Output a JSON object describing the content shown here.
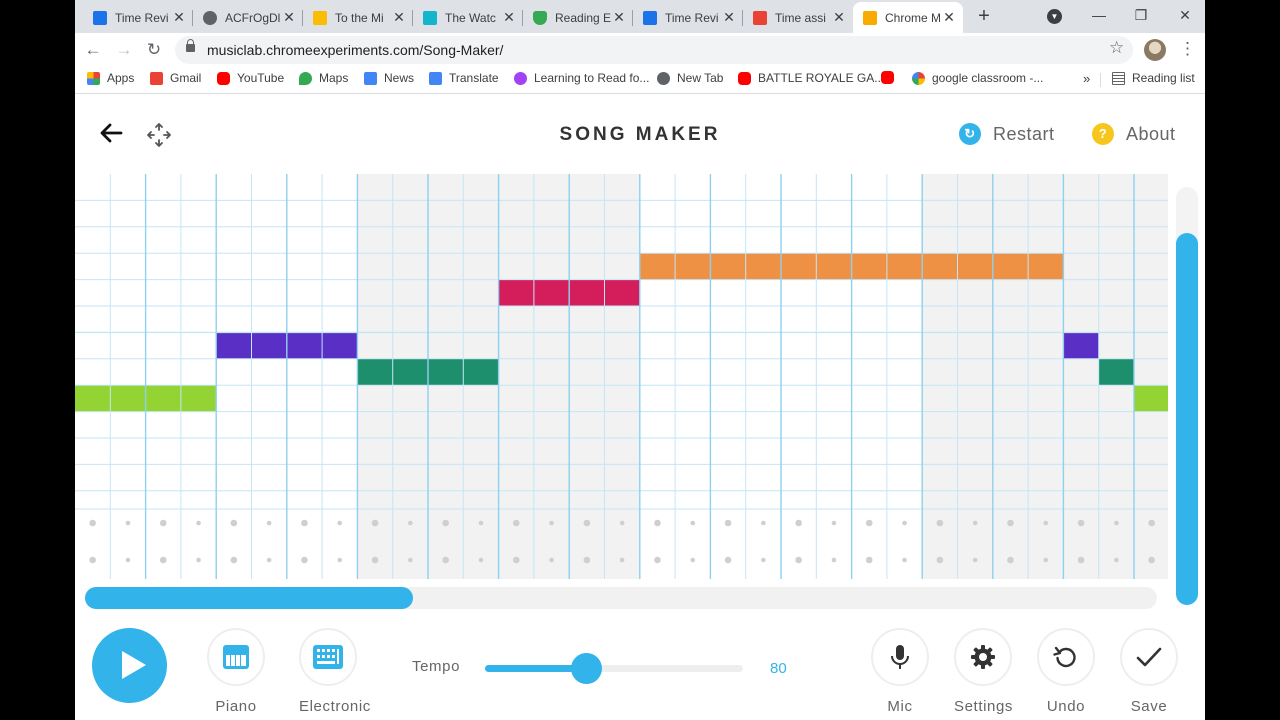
{
  "tabs": [
    {
      "label": "Time Revi",
      "fav": "#1a73e8",
      "icon": "classroom-icon"
    },
    {
      "label": "ACFrOgDl",
      "fav": "#5f6368",
      "icon": "globe-icon"
    },
    {
      "label": "To the Mi",
      "fav": "#fbbc04",
      "icon": "slides-icon"
    },
    {
      "label": "The Watc",
      "fav": "#12b5cb",
      "icon": "site-icon"
    },
    {
      "label": "Reading E",
      "fav": "#34a853",
      "icon": "shield-icon"
    },
    {
      "label": "Time Revi",
      "fav": "#1a73e8",
      "icon": "classroom-icon"
    },
    {
      "label": "Time assi",
      "fav": "#ea4335",
      "icon": "gmail-icon"
    },
    {
      "label": "Chrome M",
      "fav": "#f9ab00",
      "icon": "chrome-music-lab-icon"
    }
  ],
  "new_tab_symbol": "+",
  "window": {
    "minimize": "—",
    "restore": "❐",
    "close": "✕"
  },
  "toolbar": {
    "back": "←",
    "forward": "→",
    "reload": "↻",
    "url": "musiclab.chromeexperiments.com/Song-Maker/",
    "star": "☆",
    "menu": "⋮"
  },
  "bookmarks": [
    {
      "label": "Apps",
      "fav": "#ea4335",
      "icon": "apps-grid-icon"
    },
    {
      "label": "Gmail",
      "fav": "#ea4335",
      "icon": "gmail-icon"
    },
    {
      "label": "YouTube",
      "fav": "#ff0000",
      "icon": "youtube-icon"
    },
    {
      "label": "Maps",
      "fav": "#34a853",
      "icon": "maps-icon"
    },
    {
      "label": "News",
      "fav": "#4285f4",
      "icon": "news-icon"
    },
    {
      "label": "Translate",
      "fav": "#4285f4",
      "icon": "translate-icon"
    },
    {
      "label": "Learning to Read fo...",
      "fav": "#a142f4",
      "icon": "egg-icon"
    },
    {
      "label": "New Tab",
      "fav": "#5f6368",
      "icon": "globe-icon"
    },
    {
      "label": "BATTLE ROYALE GA...",
      "fav": "#ff0000",
      "icon": "youtube-icon"
    },
    {
      "label": "",
      "fav": "#ff0000",
      "icon": "youtube-icon"
    },
    {
      "label": "google classroom -...",
      "fav": "#4285f4",
      "icon": "google-icon"
    }
  ],
  "bookmarks_more": "»",
  "reading_list": "Reading list",
  "app": {
    "title": "SONG MAKER",
    "restart": "Restart",
    "about": "About",
    "about_glyph": "?",
    "restart_glyph": "↻"
  },
  "melody": [
    {
      "col": 0,
      "len": 4,
      "row": 8,
      "color": "#93d434"
    },
    {
      "col": 4,
      "len": 4,
      "row": 6,
      "color": "#5a2fc6"
    },
    {
      "col": 8,
      "len": 4,
      "row": 7,
      "color": "#1e8f6c"
    },
    {
      "col": 12,
      "len": 4,
      "row": 4,
      "color": "#d41e5c"
    },
    {
      "col": 16,
      "len": 12,
      "row": 3,
      "color": "#ee9145"
    },
    {
      "col": 28,
      "len": 1,
      "row": 6,
      "color": "#5a2fc6"
    },
    {
      "col": 29,
      "len": 1,
      "row": 7,
      "color": "#1e8f6c"
    },
    {
      "col": 30,
      "len": 1,
      "row": 8,
      "color": "#93d434"
    }
  ],
  "controls": {
    "piano": "Piano",
    "electronic": "Electronic",
    "tempo_label": "Tempo",
    "tempo": 80,
    "tempo_fraction": 0.39,
    "mic": "Mic",
    "settings": "Settings",
    "undo": "Undo",
    "save": "Save"
  },
  "colors": {
    "accent": "#32b4ea",
    "gridline": "#c4e6f6",
    "beatline": "#8fd0ee",
    "shaded": "#f2f2f2"
  }
}
